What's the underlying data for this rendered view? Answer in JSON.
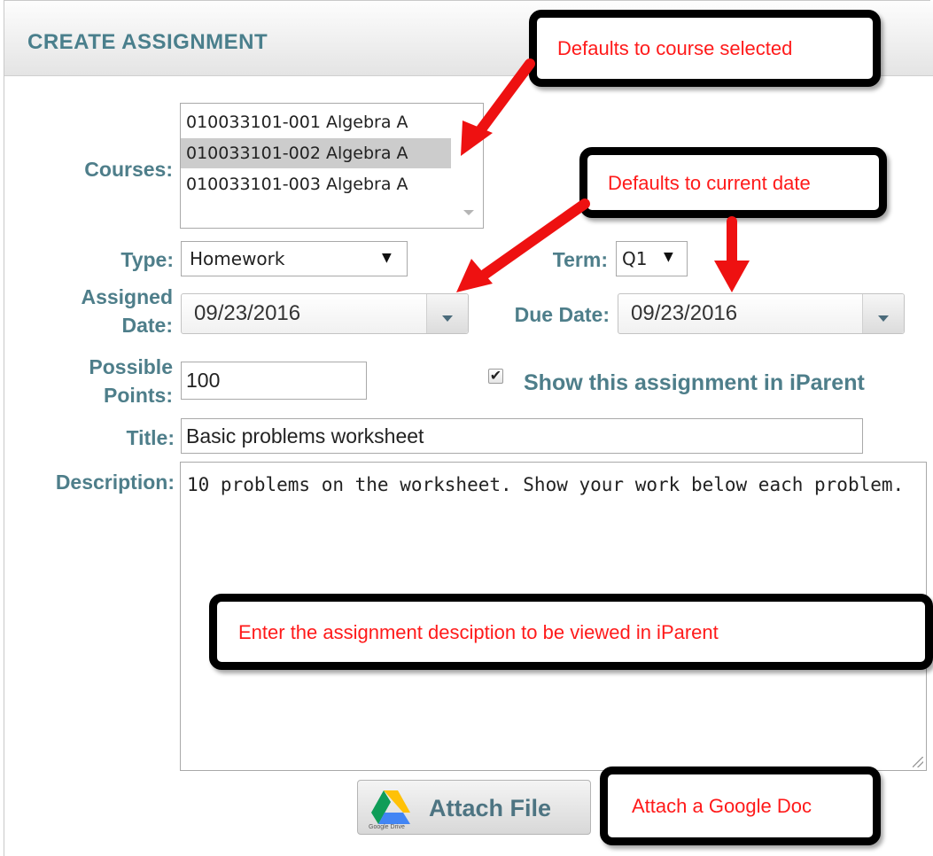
{
  "header": {
    "title": "CREATE ASSIGNMENT"
  },
  "labels": {
    "courses": "Courses:",
    "type": "Type:",
    "term": "Term:",
    "assigned_line1": "Assigned",
    "assigned_line2": "Date:",
    "due_date": "Due Date:",
    "possible_line1": "Possible",
    "possible_line2": "Points:",
    "title": "Title:",
    "description": "Description:"
  },
  "courses": {
    "options": [
      "010033101-001 Algebra A",
      "010033101-002 Algebra A",
      "010033101-003 Algebra A"
    ],
    "selected_index": 1
  },
  "type_select": {
    "value": "Homework",
    "arrow": "▼"
  },
  "term_select": {
    "value": "Q1",
    "arrow": "▼"
  },
  "assigned_date": {
    "value": "09/23/2016"
  },
  "due_date": {
    "value": "09/23/2016"
  },
  "possible_points": {
    "value": "100"
  },
  "show_in_iparent": {
    "checked": true,
    "mark": "✔",
    "label": "Show this assignment in iParent"
  },
  "title_field": {
    "value": "Basic problems worksheet"
  },
  "description_field": {
    "value": "10 problems on the worksheet. Show your work below each problem."
  },
  "attach_button": {
    "label": "Attach File",
    "icon_caption": "Google Drive"
  },
  "callouts": {
    "course_default": "Defaults to course selected",
    "date_default": "Defaults to current date",
    "description_note": "Enter the assignment desciption to be viewed in iParent",
    "attach_note": "Attach a Google Doc"
  },
  "colors": {
    "label": "#4e7e8a",
    "callout_text": "#ff1a1a",
    "arrow": "#ee1111"
  }
}
